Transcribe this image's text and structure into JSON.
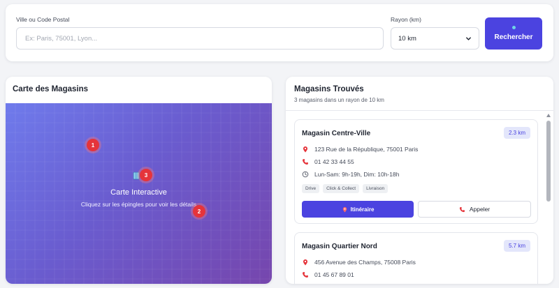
{
  "search": {
    "city_label": "Ville ou Code Postal",
    "city_placeholder": "Ex: Paris, 75001, Lyon...",
    "city_value": "",
    "radius_label": "Rayon (km)",
    "radius_selected": "10 km",
    "search_button_label": "Rechercher"
  },
  "map": {
    "title": "Carte des Magasins",
    "heading": "Carte Interactive",
    "subtitle": "Cliquez sur les épingles pour voir les détails",
    "pins": [
      "1",
      "2",
      "3"
    ]
  },
  "stores": {
    "title": "Magasins Trouvés",
    "subtitle": "3 magasins dans un rayon de 10 km",
    "items": [
      {
        "name": "Magasin Centre-Ville",
        "distance": "2.3 km",
        "address": "123 Rue de la République, 75001 Paris",
        "phone": "01 42 33 44 55",
        "hours": "Lun-Sam: 9h-19h, Dim: 10h-18h",
        "tags": [
          "Drive",
          "Click & Collect",
          "Livraison"
        ],
        "route_label": "Itinéraire",
        "call_label": "Appeler"
      },
      {
        "name": "Magasin Quartier Nord",
        "distance": "5.7 km",
        "address": "456 Avenue des Champs, 75008 Paris",
        "phone": "01 45 67 89 01"
      }
    ]
  },
  "colors": {
    "accent": "#4b43e0",
    "pin": "#e5343b",
    "map_gradient_start": "#6f7bec",
    "map_gradient_end": "#7646ad",
    "badge_bg": "#e3e6fb"
  },
  "icons": {
    "location": "map-pin-icon",
    "phone": "phone-icon",
    "hours": "clock-icon",
    "map": "map-icon",
    "select": "chevron-down-icon"
  }
}
